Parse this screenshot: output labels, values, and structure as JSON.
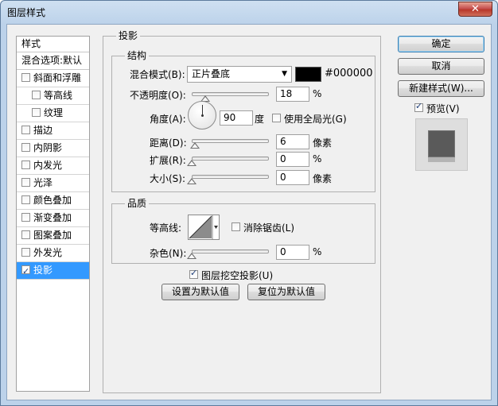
{
  "window": {
    "title": "图层样式",
    "close_glyph": "✕"
  },
  "style_list": {
    "header": "样式",
    "blend_options": "混合选项:默认",
    "items": [
      {
        "label": "斜面和浮雕",
        "checked": false,
        "sub": false
      },
      {
        "label": "等高线",
        "checked": false,
        "sub": true
      },
      {
        "label": "纹理",
        "checked": false,
        "sub": true
      },
      {
        "label": "描边",
        "checked": false,
        "sub": false
      },
      {
        "label": "内阴影",
        "checked": false,
        "sub": false
      },
      {
        "label": "内发光",
        "checked": false,
        "sub": false
      },
      {
        "label": "光泽",
        "checked": false,
        "sub": false
      },
      {
        "label": "颜色叠加",
        "checked": false,
        "sub": false
      },
      {
        "label": "渐变叠加",
        "checked": false,
        "sub": false
      },
      {
        "label": "图案叠加",
        "checked": false,
        "sub": false
      },
      {
        "label": "外发光",
        "checked": false,
        "sub": false
      },
      {
        "label": "投影",
        "checked": true,
        "sub": false,
        "selected": true
      }
    ]
  },
  "drop_shadow": {
    "title": "投影",
    "structure": {
      "title": "结构",
      "blend_mode_label": "混合模式(B):",
      "blend_mode_value": "正片叠底",
      "color_hex": "#000000",
      "color_value": "#000000",
      "opacity_label": "不透明度(O):",
      "opacity_value": "18",
      "opacity_unit": "%",
      "opacity_level": 0.18,
      "angle_label": "角度(A):",
      "angle_value": "90",
      "angle_unit": "度",
      "global_light_label": "使用全局光(G)",
      "global_light_checked": false,
      "distance_label": "距离(D):",
      "distance_value": "6",
      "distance_unit": "像素",
      "spread_label": "扩展(R):",
      "spread_value": "0",
      "spread_unit": "%",
      "size_label": "大小(S):",
      "size_value": "0",
      "size_unit": "像素"
    },
    "quality": {
      "title": "品质",
      "contour_label": "等高线:",
      "antialias_label": "消除锯齿(L)",
      "antialias_checked": false,
      "noise_label": "杂色(N):",
      "noise_value": "0",
      "noise_unit": "%"
    },
    "knockout_label": "图层挖空投影(U)",
    "knockout_checked": true,
    "make_default_label": "设置为默认值",
    "reset_default_label": "复位为默认值"
  },
  "actions": {
    "ok_label": "确定",
    "cancel_label": "取消",
    "new_style_label": "新建样式(W)...",
    "preview_label": "预览(V)",
    "preview_checked": true
  }
}
